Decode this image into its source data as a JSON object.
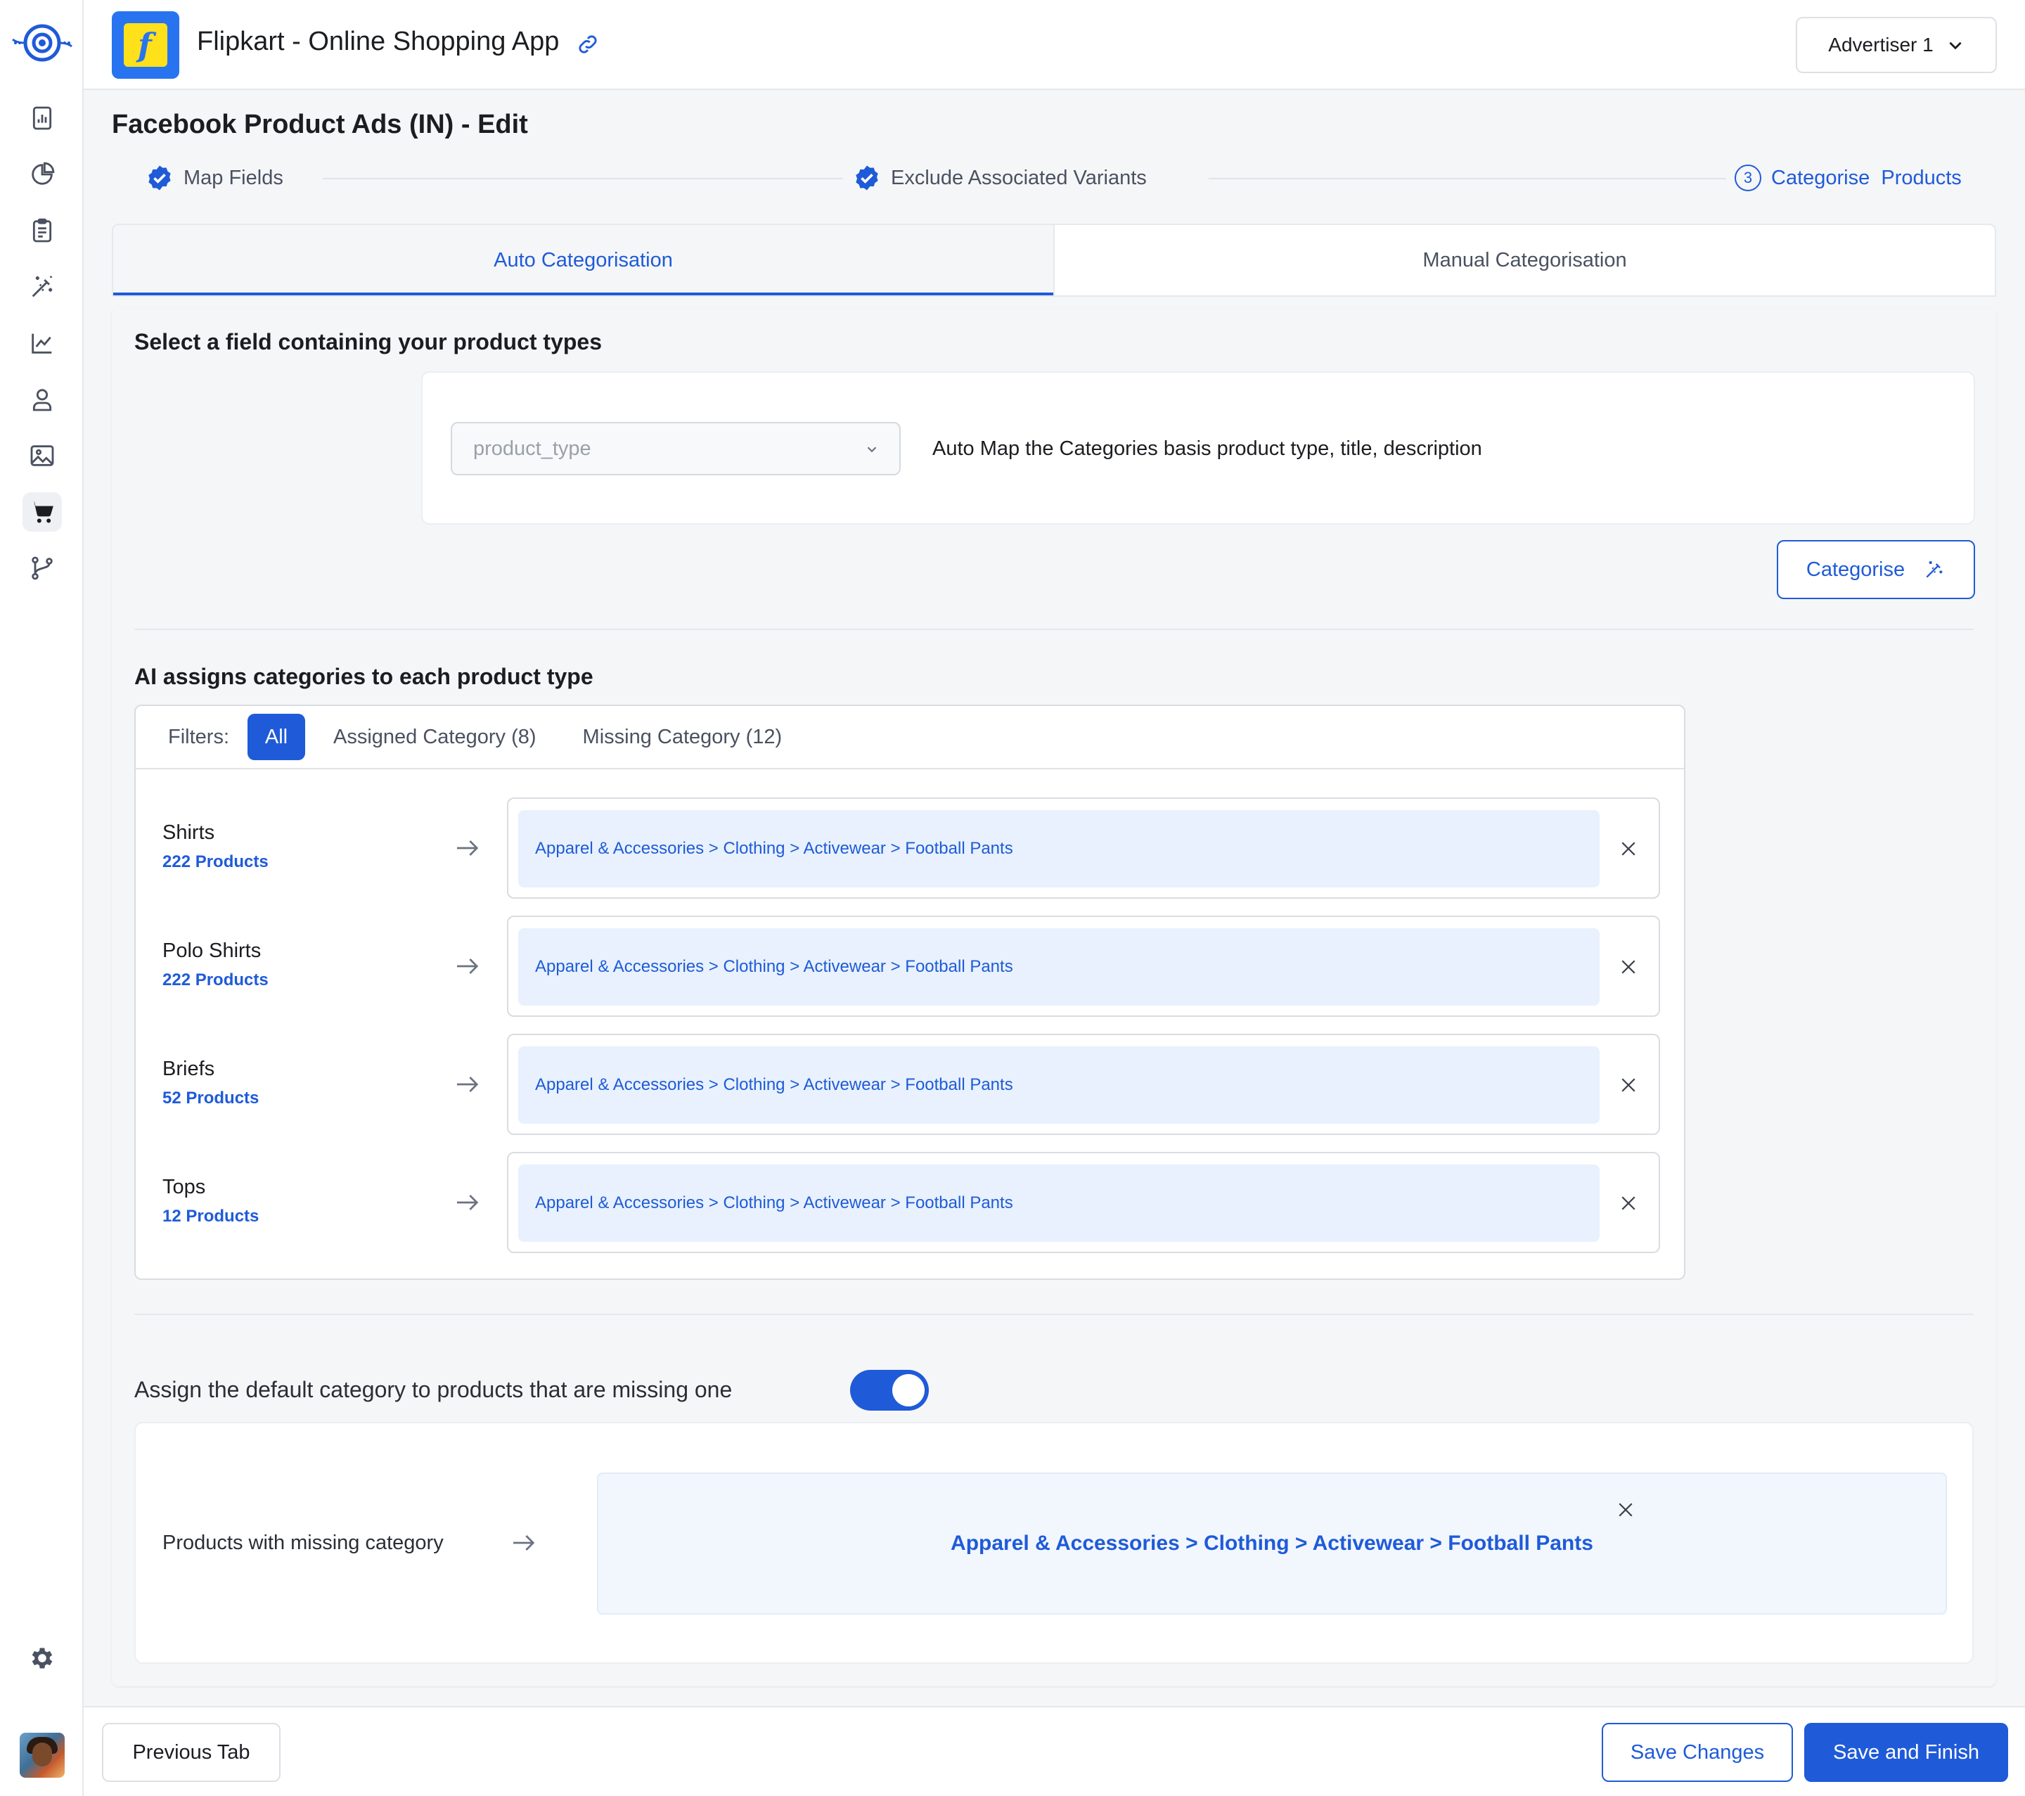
{
  "sidebar": {
    "logo_icon": "eye-logo-icon",
    "items": [
      {
        "icon": "report-icon"
      },
      {
        "icon": "pie-chart-icon"
      },
      {
        "icon": "clipboard-icon"
      },
      {
        "icon": "magic-wand-icon"
      },
      {
        "icon": "line-chart-icon"
      },
      {
        "icon": "user-icon"
      },
      {
        "icon": "image-icon"
      },
      {
        "icon": "cart-icon",
        "active": true
      },
      {
        "icon": "git-branch-icon"
      }
    ],
    "settings_icon": "gear-icon",
    "avatar_icon": "user-avatar"
  },
  "header": {
    "app_title": "Flipkart - Online Shopping App",
    "advertiser": "Advertiser 1"
  },
  "page": {
    "title": "Facebook Product Ads (IN) - Edit"
  },
  "stepper": {
    "steps": [
      {
        "label": "Map Fields",
        "state": "done"
      },
      {
        "label": "Exclude Associated Variants",
        "state": "done"
      },
      {
        "number": "3",
        "label": "Categorise  Products",
        "state": "current"
      }
    ]
  },
  "tabs": [
    {
      "label": "Auto Categorisation",
      "active": true
    },
    {
      "label": "Manual Categorisation",
      "active": false
    }
  ],
  "field_section": {
    "title": "Select a field containing your product types",
    "select_placeholder": "product_type",
    "description": "Auto Map the Categories basis product type, title, description",
    "categorise_button": "Categorise"
  },
  "ai_section": {
    "title": "AI assigns categories to each product type",
    "filters_label": "Filters:",
    "filters": [
      "All",
      "Assigned Category (8)",
      "Missing Category (12)"
    ],
    "rows": [
      {
        "name": "Shirts",
        "count": "222 Products",
        "category": "Apparel & Accessories > Clothing > Activewear > Football Pants"
      },
      {
        "name": "Polo Shirts",
        "count": "222 Products",
        "category": "Apparel & Accessories > Clothing > Activewear > Football Pants"
      },
      {
        "name": "Briefs",
        "count": "52 Products",
        "category": "Apparel & Accessories > Clothing > Activewear > Football Pants"
      },
      {
        "name": "Tops",
        "count": "12 Products",
        "category": "Apparel & Accessories > Clothing > Activewear > Football Pants"
      }
    ]
  },
  "default_section": {
    "toggle_label": "Assign the default category to products that are missing one",
    "toggle_on": true,
    "missing_label": "Products with missing category",
    "default_category": "Apparel & Accessories > Clothing > Activewear > Football Pants"
  },
  "footer": {
    "previous": "Previous Tab",
    "save": "Save Changes",
    "finish": "Save and Finish"
  },
  "colors": {
    "accent": "#1f5bd8",
    "pill_bg": "#e8f1fd",
    "page_bg": "#f5f6f8"
  }
}
